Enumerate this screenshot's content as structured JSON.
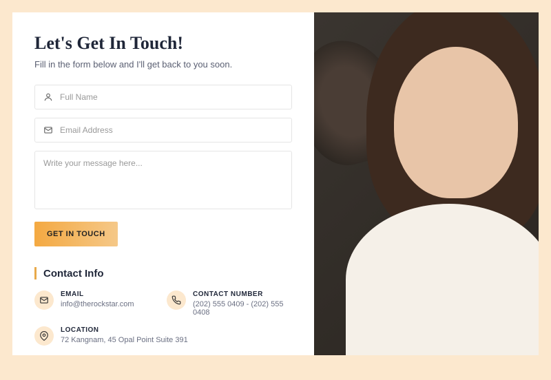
{
  "heading": "Let's Get In Touch!",
  "subtitle": "Fill in the form below and I'll get back to you soon.",
  "form": {
    "name_placeholder": "Full Name",
    "email_placeholder": "Email Address",
    "message_placeholder": "Write your message here...",
    "submit_label": "GET IN TOUCH"
  },
  "contact": {
    "title": "Contact Info",
    "email": {
      "label": "EMAIL",
      "value": "info@therockstar.com"
    },
    "phone": {
      "label": "CONTACT NUMBER",
      "value": "(202) 555 0409 - (202) 555 0408"
    },
    "location": {
      "label": "LOCATION",
      "value": "72 Kangnam, 45 Opal Point Suite 391"
    }
  }
}
